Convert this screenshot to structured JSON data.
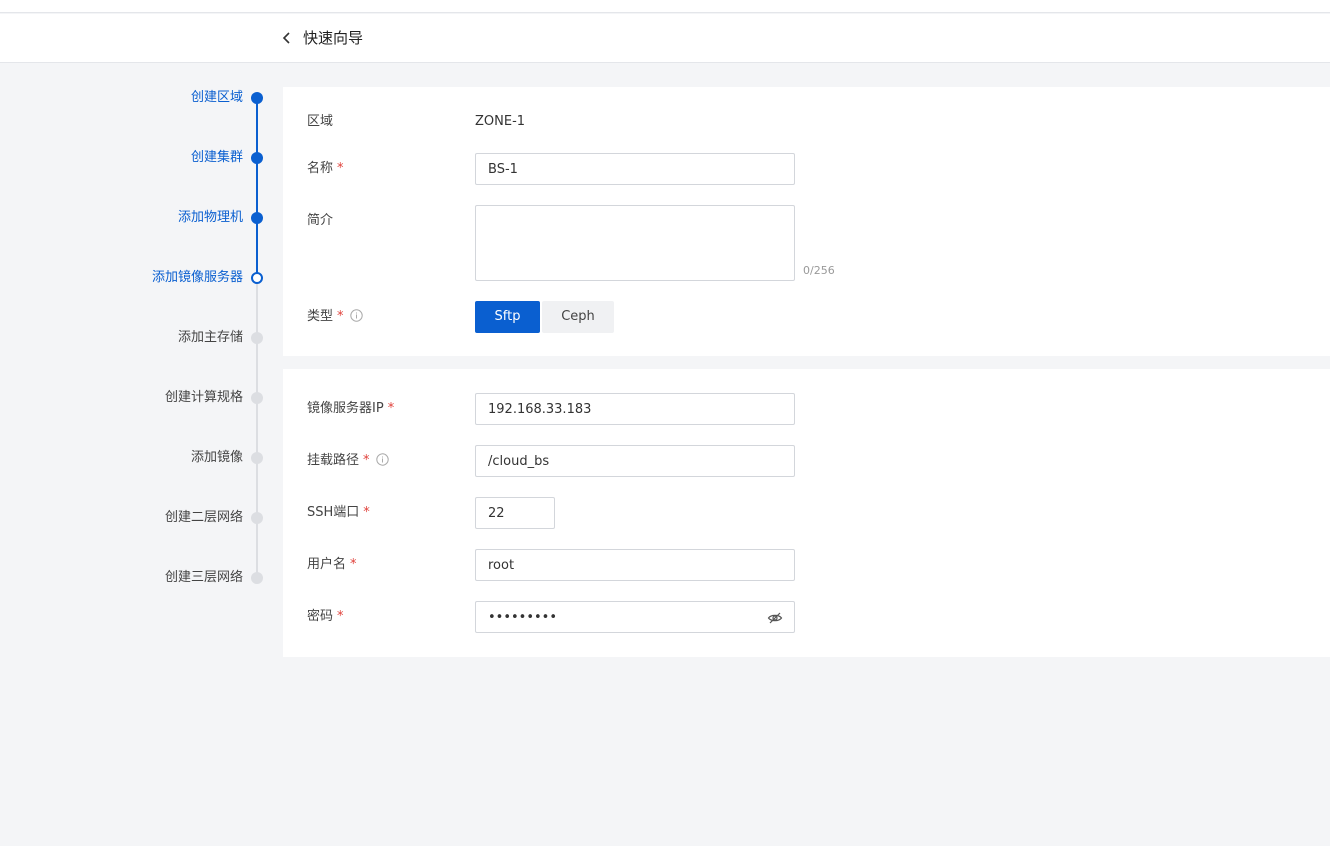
{
  "header": {
    "title": "快速向导"
  },
  "steps": [
    {
      "label": "创建区域",
      "state": "done"
    },
    {
      "label": "创建集群",
      "state": "done"
    },
    {
      "label": "添加物理机",
      "state": "done"
    },
    {
      "label": "添加镜像服务器",
      "state": "current"
    },
    {
      "label": "添加主存储",
      "state": "pending"
    },
    {
      "label": "创建计算规格",
      "state": "pending"
    },
    {
      "label": "添加镜像",
      "state": "pending"
    },
    {
      "label": "创建二层网络",
      "state": "pending"
    },
    {
      "label": "创建三层网络",
      "state": "pending"
    }
  ],
  "basic": {
    "zone_label": "区域",
    "zone_value": "ZONE-1",
    "name_label": "名称",
    "name_value": "BS-1",
    "desc_label": "简介",
    "desc_value": "",
    "desc_counter": "0/256",
    "type_label": "类型",
    "type_options": [
      "Sftp",
      "Ceph"
    ],
    "type_selected": "Sftp"
  },
  "connection": {
    "ip_label": "镜像服务器IP",
    "ip_value": "192.168.33.183",
    "path_label": "挂载路径",
    "path_value": "/cloud_bs",
    "port_label": "SSH端口",
    "port_value": "22",
    "user_label": "用户名",
    "user_value": "root",
    "password_label": "密码",
    "password_value": "•••••••••"
  },
  "required_mark": "*",
  "colors": {
    "primary": "#0a5fd0",
    "required": "#e0403a",
    "pending": "#dcdee2"
  }
}
